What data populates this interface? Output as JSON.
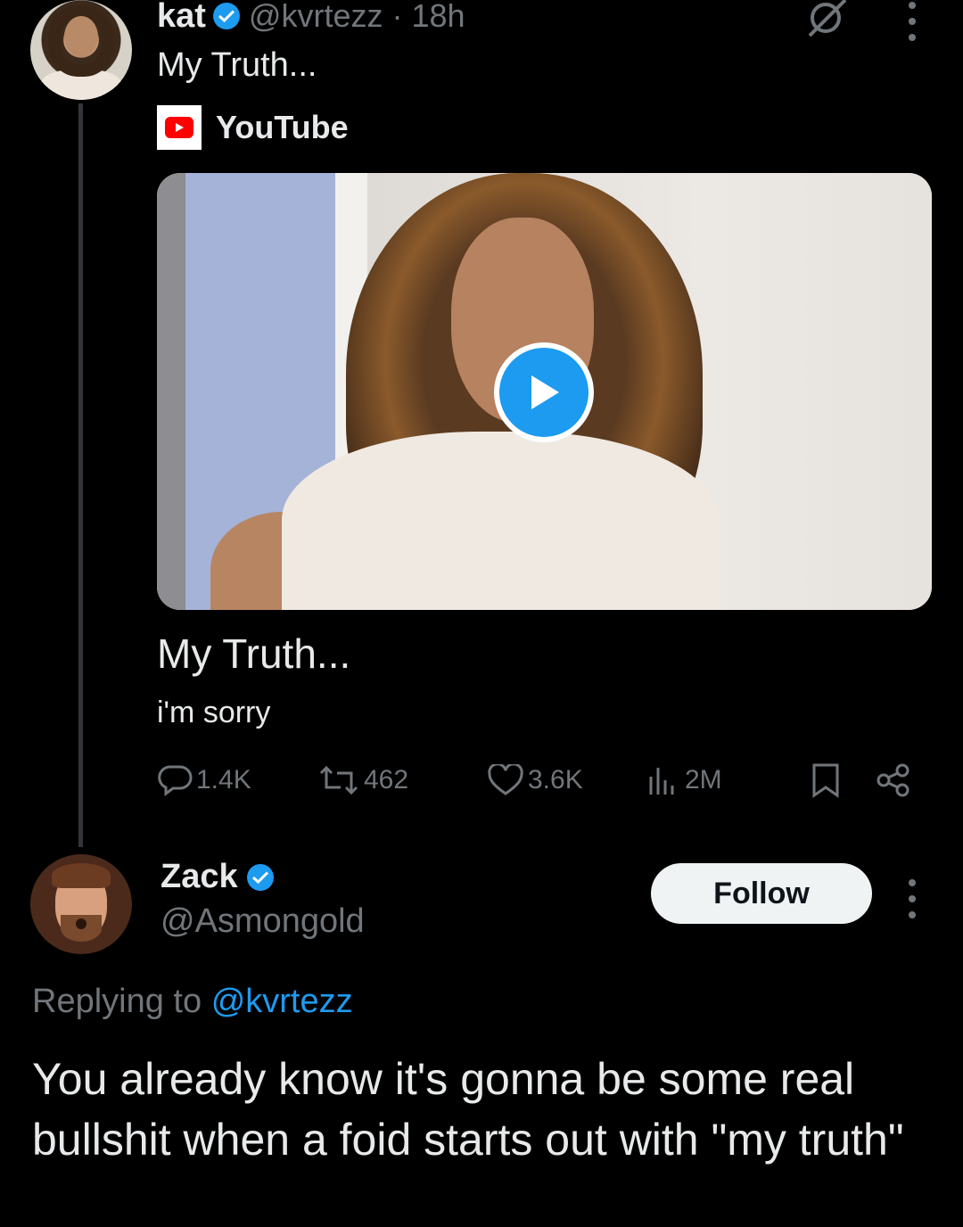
{
  "tweet": {
    "author_name": "kat",
    "author_handle": "@kvrtezz",
    "time": "18h",
    "text": "My Truth...",
    "card": {
      "source_label": "YouTube",
      "title": "My Truth...",
      "description": "i'm sorry"
    },
    "actions": {
      "replies": "1.4K",
      "reposts": "462",
      "likes": "3.6K",
      "views": "2M"
    }
  },
  "reply": {
    "author_name": "Zack",
    "author_handle": "@Asmongold",
    "follow_label": "Follow",
    "replying_prefix": "Replying to",
    "replying_mention": "@kvrtezz",
    "text": "You already know it's gonna be some real bullshit when a foid starts out with \"my truth\""
  },
  "colors": {
    "background": "#000000",
    "accent": "#1d9bf0",
    "muted": "#71767b",
    "text": "#e7e9ea"
  },
  "icons": [
    "verified-badge-icon",
    "grok-icon",
    "more-icon",
    "youtube-icon",
    "play-icon",
    "reply-icon",
    "repost-icon",
    "like-icon",
    "views-icon",
    "bookmark-icon",
    "share-icon"
  ]
}
